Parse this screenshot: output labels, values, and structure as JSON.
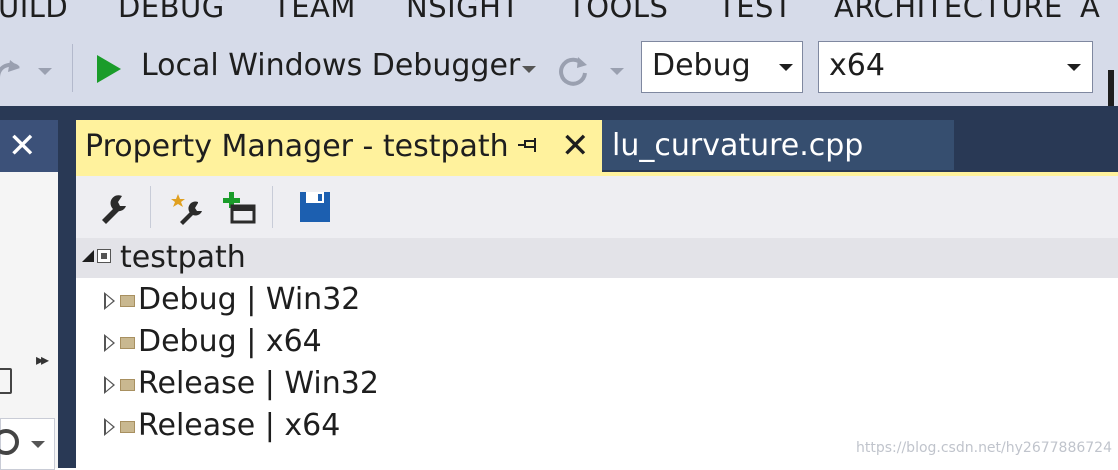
{
  "menu": {
    "items": [
      "UILD",
      "DEBUG",
      "TEAM",
      "NSIGHT",
      "TOOLS",
      "TEST",
      "ARCHITECTURE",
      "A"
    ]
  },
  "toolbar": {
    "debugger_label": "Local Windows Debugger",
    "configuration": "Debug",
    "platform": "x64"
  },
  "tabs": {
    "active": "Property Manager - testpath",
    "inactive": "lu_curvature.cpp"
  },
  "tree": {
    "root": "testpath",
    "children": [
      "Debug | Win32",
      "Debug | x64",
      "Release | Win32",
      "Release | x64"
    ]
  },
  "icons": {
    "run": "play-icon",
    "restart": "refresh-icon",
    "pin": "pin-icon",
    "close": "close-icon",
    "properties": "wrench-icon",
    "add_new": "add-property-sheet-icon",
    "add_existing": "magic-wrench-icon",
    "save": "save-icon"
  },
  "colors": {
    "menu_bg": "#d6dbe9",
    "active_tab": "#fff29d",
    "inactive_tab": "#364e6f",
    "dark_bg": "#293955",
    "run_green": "#1a9c2a",
    "save_blue": "#1c5fb0"
  },
  "watermark": "https://blog.csdn.net/hy2677886724"
}
